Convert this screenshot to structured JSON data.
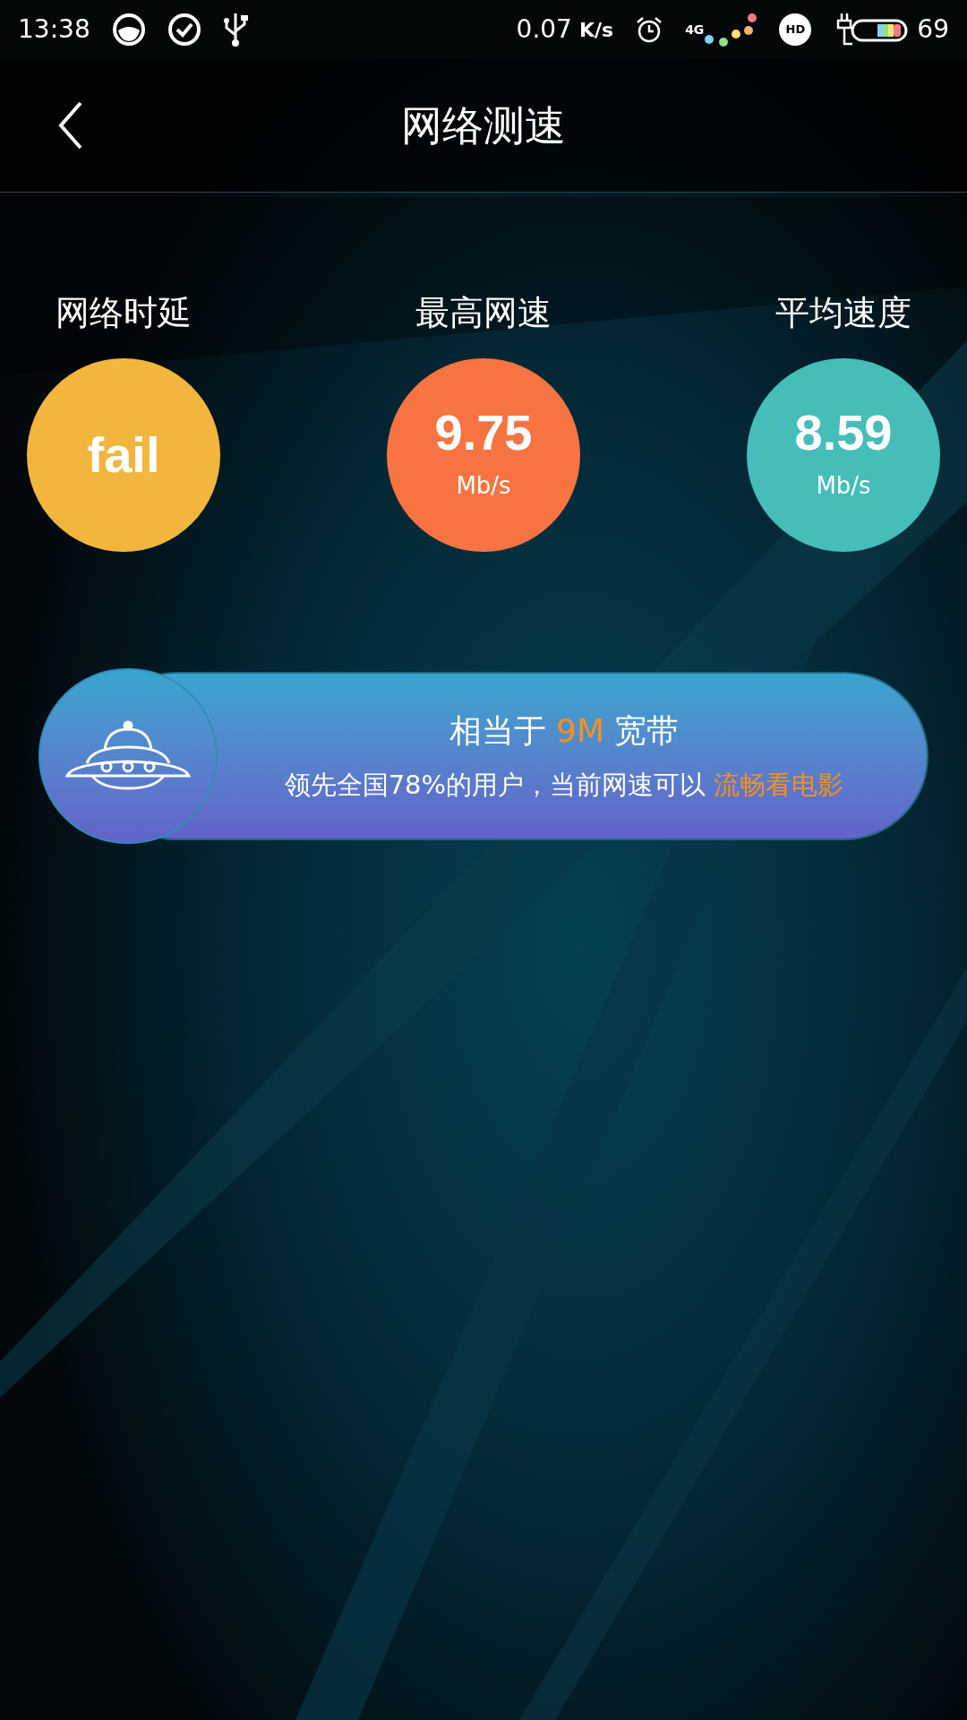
{
  "status_bar": {
    "time": "13:38",
    "speed": "0.07",
    "speed_unit": "K/s",
    "network": "4G",
    "hd": "HD",
    "battery": "69"
  },
  "header": {
    "title": "网络测速"
  },
  "metrics": [
    {
      "label": "网络时延",
      "value": "fail",
      "color": "#f2b63e"
    },
    {
      "label": "最高网速",
      "value": "9.75",
      "unit": "Mb/s",
      "color": "#f77442"
    },
    {
      "label": "平均速度",
      "value": "8.59",
      "unit": "Mb/s",
      "color": "#45bdb9"
    }
  ],
  "banner": {
    "line1": {
      "before": "相当于",
      "highlight": "9M",
      "after": "宽带"
    },
    "line2": {
      "before": "领先全国78%的用户，当前网速可以",
      "highlight": "流畅看电影"
    }
  }
}
